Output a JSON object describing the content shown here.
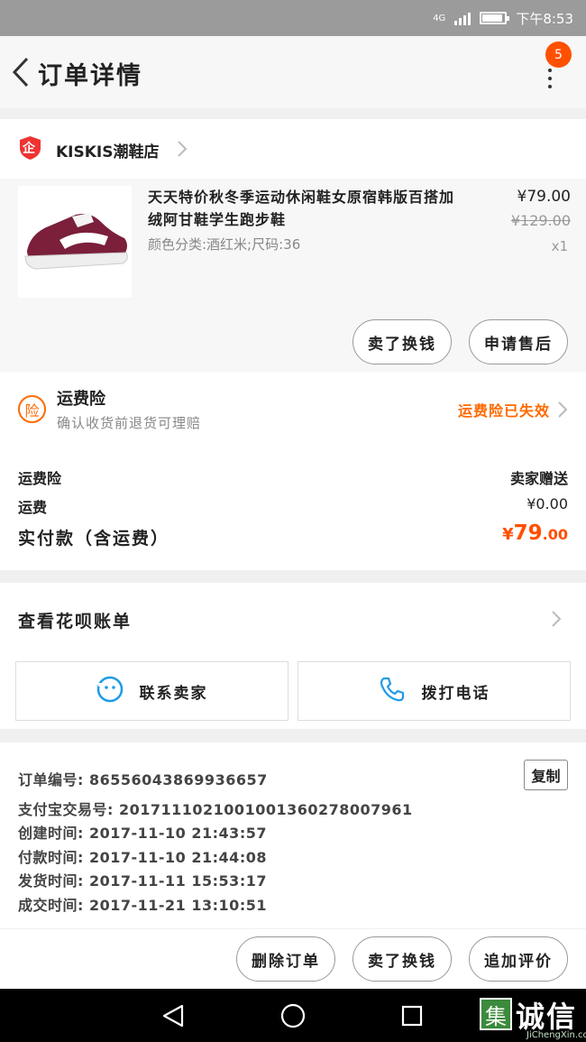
{
  "status_bar": {
    "network": "4G",
    "time": "下午8:53"
  },
  "header": {
    "title": "订单详情",
    "badge_count": "5"
  },
  "shop": {
    "name": "KISKIS潮鞋店",
    "logo_char": "企"
  },
  "item": {
    "title": "天天特价秋冬季运动休闲鞋女原宿韩版百搭加绒阿甘鞋学生跑步鞋",
    "sku": "颜色分类:酒红米;尺码:36",
    "price": "¥79.00",
    "original_price": "¥129.00",
    "quantity": "x1",
    "actions": [
      "卖了换钱",
      "申请售后"
    ]
  },
  "insurance": {
    "icon_char": "险",
    "title": "运费险",
    "subtitle": "确认收货前退货可理赔",
    "status": "运费险已失效"
  },
  "fees": [
    {
      "label": "运费险",
      "value": "卖家赠送"
    },
    {
      "label": "运费",
      "value": "¥0.00"
    }
  ],
  "total": {
    "label": "实付款（含运费）",
    "currency": "¥",
    "integer": "79",
    "decimal": ".00"
  },
  "bill": {
    "label": "查看花呗账单"
  },
  "contact": {
    "seller_label": "联系卖家",
    "call_label": "拨打电话"
  },
  "order_info": {
    "lines": [
      "订单编号: 86556043869936657",
      "支付宝交易号: 2017111021001001360278007961",
      "创建时间: 2017-11-10 21:43:57",
      "付款时间: 2017-11-10 21:44:08",
      "发货时间: 2017-11-11 15:53:17",
      "成交时间: 2017-11-21 13:10:51"
    ],
    "copy_label": "复制"
  },
  "bottom_actions": [
    "删除订单",
    "卖了换钱",
    "追加评价"
  ],
  "watermark": {
    "box_char": "集",
    "main": "诚信",
    "sub": "JiChengXin.com"
  },
  "colors": {
    "accent": "#ff5000",
    "insurance": "#ff6a00",
    "phone_blue": "#1e9be8"
  },
  "icons": [
    "back-arrow-icon",
    "more-icon",
    "shop-badge-icon",
    "chevron-right-icon",
    "insurance-icon",
    "chat-face-icon",
    "phone-icon",
    "nav-back-icon",
    "nav-home-icon",
    "nav-recent-icon"
  ]
}
